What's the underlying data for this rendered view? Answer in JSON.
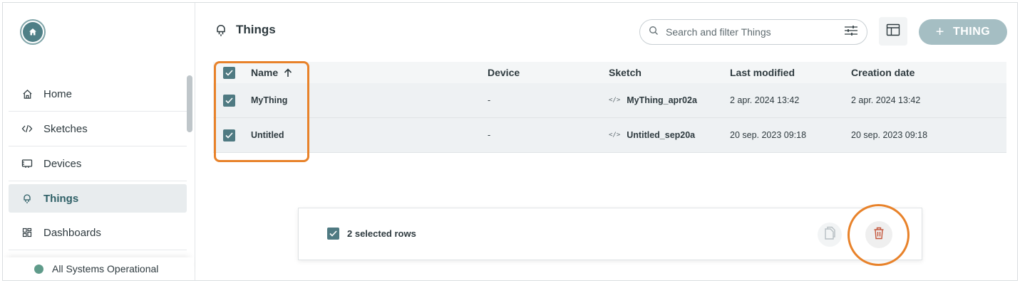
{
  "app": {
    "status_text": "All Systems Operational",
    "status_color": "#5f9b8a",
    "accent": "#4f7a82",
    "highlight": "#e8822a"
  },
  "sidebar": {
    "items": [
      {
        "label": "Home",
        "icon": "home-icon",
        "active": false
      },
      {
        "label": "Sketches",
        "icon": "code-icon",
        "active": false
      },
      {
        "label": "Devices",
        "icon": "device-icon",
        "active": false
      },
      {
        "label": "Things",
        "icon": "thing-icon",
        "active": true
      },
      {
        "label": "Dashboards",
        "icon": "dashboard-icon",
        "active": false
      }
    ]
  },
  "header": {
    "title": "Things",
    "search_placeholder": "Search and filter Things",
    "add_label": "THING"
  },
  "table": {
    "columns": [
      "Name",
      "Device",
      "Sketch",
      "Last modified",
      "Creation date"
    ],
    "sort_column": "Name",
    "rows": [
      {
        "name": "MyThing",
        "device": "-",
        "sketch": "MyThing_apr02a",
        "last_modified": "2 apr. 2024 13:42",
        "created": "2 apr. 2024 13:42",
        "selected": true
      },
      {
        "name": "Untitled",
        "device": "-",
        "sketch": "Untitled_sep20a",
        "last_modified": "20 sep. 2023 09:18",
        "created": "20 sep. 2023 09:18",
        "selected": true
      }
    ]
  },
  "selection": {
    "label": "2 selected rows"
  }
}
